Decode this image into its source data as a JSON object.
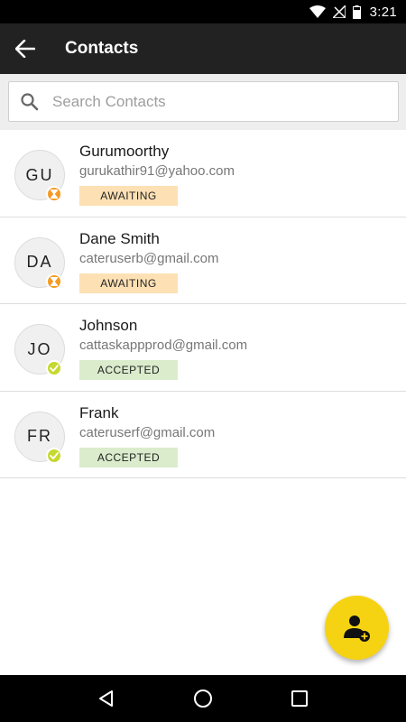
{
  "status_bar": {
    "time": "3:21",
    "icons": [
      "wifi-icon",
      "no-signal-icon",
      "battery-icon"
    ]
  },
  "app_bar": {
    "title": "Contacts",
    "back_icon": "arrow-back-icon"
  },
  "search": {
    "placeholder": "Search Contacts",
    "value": "",
    "icon": "search-icon"
  },
  "contacts": [
    {
      "initials": "GU",
      "name": "Gurumoorthy",
      "email": "gurukathir91@yahoo.com",
      "status": "AWAITING",
      "badge_icon": "hourglass-icon"
    },
    {
      "initials": "DA",
      "name": "Dane Smith",
      "email": "cateruserb@gmail.com",
      "status": "AWAITING",
      "badge_icon": "hourglass-icon"
    },
    {
      "initials": "JO",
      "name": "Johnson",
      "email": "cattaskappprod@gmail.com",
      "status": "ACCEPTED",
      "badge_icon": "check-icon"
    },
    {
      "initials": "FR",
      "name": "Frank",
      "email": "cateruserf@gmail.com",
      "status": "ACCEPTED",
      "badge_icon": "check-icon"
    }
  ],
  "fab": {
    "icon": "add-contact-icon"
  },
  "nav_bar": {
    "icons": [
      "back-triangle-icon",
      "home-circle-icon",
      "recents-square-icon"
    ]
  },
  "colors": {
    "app_bar": "#222222",
    "accent_fab": "#f6d312",
    "awaiting_badge": "#f59a23",
    "awaiting_pill": "#fde0b4",
    "accepted_badge": "#c6d92e",
    "accepted_pill": "#daeccc"
  }
}
